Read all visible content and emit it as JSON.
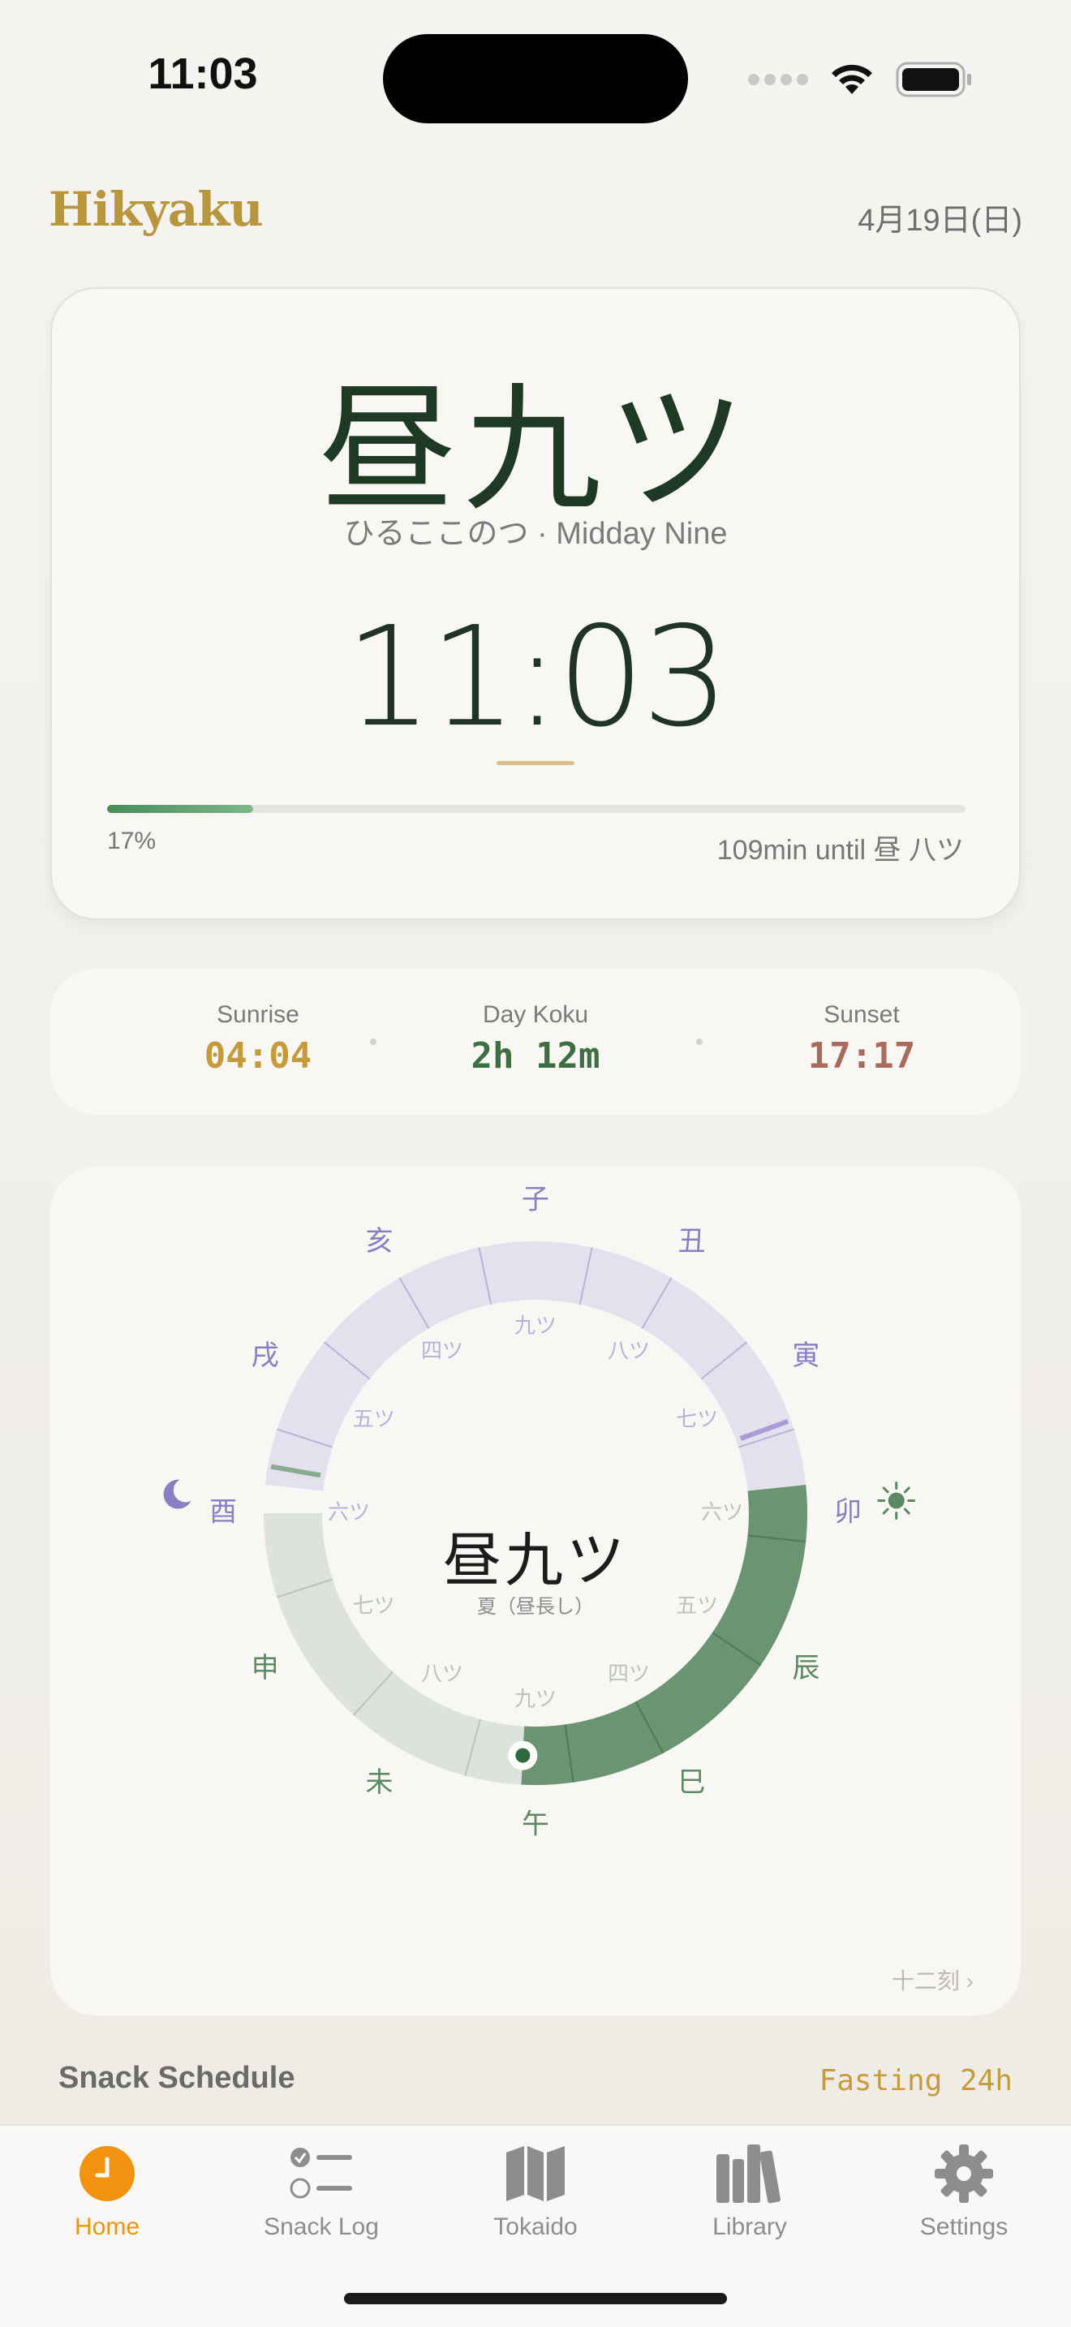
{
  "status_bar": {
    "time": "11:03"
  },
  "header": {
    "brand": "Hikyaku",
    "date": "4月19日(日)"
  },
  "hero": {
    "current_koku": "昼九ツ",
    "reading": "ひるここのつ · Midday Nine",
    "clock": "11:03",
    "progress_percent": 17,
    "progress_label": "17%",
    "remaining_label": "109min until 昼 八ツ"
  },
  "sun": {
    "sunrise_label": "Sunrise",
    "sunrise_value": "04:04",
    "koku_label": "Day Koku",
    "koku_value": "2h 12m",
    "sunset_label": "Sunset",
    "sunset_value": "17:17"
  },
  "wheel": {
    "center_label": "昼九ツ",
    "season_label": "夏（昼長し）",
    "link_label": "十二刻 ›",
    "zodiac": [
      "子",
      "丑",
      "寅",
      "卯",
      "辰",
      "巳",
      "午",
      "未",
      "申",
      "酉",
      "戌",
      "亥"
    ],
    "inner_night": [
      "九ツ",
      "八ツ",
      "七ツ",
      "六ツ",
      "五ツ",
      "四ツ"
    ],
    "inner_day": [
      "六ツ",
      "五ツ",
      "四ツ",
      "九ツ",
      "八ツ",
      "七ツ"
    ]
  },
  "snack": {
    "title": "Snack Schedule",
    "status": "Fasting 24h"
  },
  "tabs": [
    {
      "label": "Home",
      "icon": "clock-icon",
      "active": true
    },
    {
      "label": "Snack Log",
      "icon": "checklist-icon",
      "active": false
    },
    {
      "label": "Tokaido",
      "icon": "map-icon",
      "active": false
    },
    {
      "label": "Library",
      "icon": "books-icon",
      "active": false
    },
    {
      "label": "Settings",
      "icon": "gear-icon",
      "active": false
    }
  ],
  "colors": {
    "brand": "#b8963e",
    "accent_green": "#3f7a4e",
    "sunrise": "#c49a3a",
    "sunset": "#a86b5c",
    "night_ring": "#e4e1ee",
    "day_ring_active": "#6b9471",
    "day_ring": "#dde3dc",
    "tab_active": "#f1930e"
  }
}
